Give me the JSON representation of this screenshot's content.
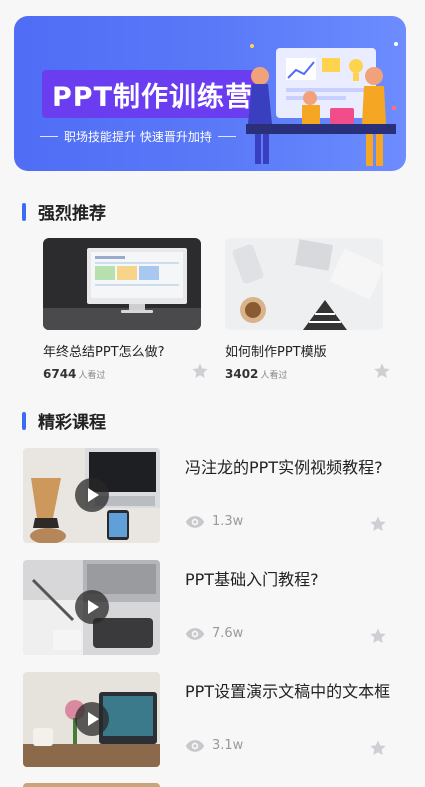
{
  "banner": {
    "title": "PPT制作训练营",
    "subtitle": "职场技能提升  快速晋升加持"
  },
  "recommend": {
    "section_title": "强烈推荐",
    "items": [
      {
        "title": "年终总结PPT怎么做?",
        "views": "6744",
        "unit": "人看过"
      },
      {
        "title": "如何制作PPT模版",
        "views": "3402",
        "unit": "人看过"
      }
    ]
  },
  "courses": {
    "section_title": "精彩课程",
    "items": [
      {
        "title": "冯注龙的PPT实例视频教程?",
        "views": "1.3w"
      },
      {
        "title": "PPT基础入门教程?",
        "views": "7.6w"
      },
      {
        "title": "PPT设置演示文稿中的文本框",
        "views": "3.1w"
      }
    ]
  },
  "icons": {
    "star": "star-icon",
    "eye": "eye-icon",
    "play": "play-icon"
  }
}
